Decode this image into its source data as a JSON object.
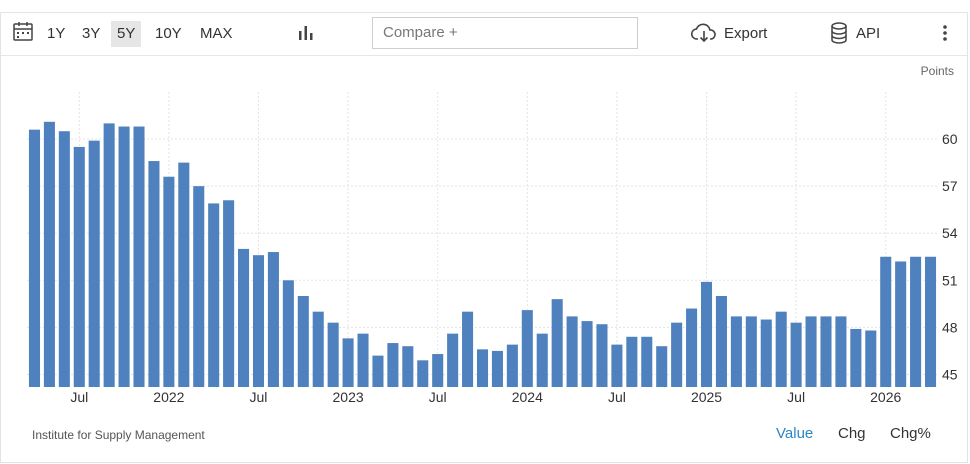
{
  "toolbar": {
    "ranges": [
      "1Y",
      "3Y",
      "5Y",
      "10Y",
      "MAX"
    ],
    "active_range": "5Y",
    "compare_placeholder": "Compare +",
    "export_label": "Export",
    "api_label": "API",
    "icons": {
      "calendar": "calendar-icon",
      "chart_type": "bar-chart-icon",
      "export": "cloud-download-icon",
      "api": "database-icon",
      "more": "vertical-dots-icon"
    }
  },
  "units_label": "Points",
  "source": "Institute for Supply Management",
  "modes": [
    "Value",
    "Chg",
    "Chg%"
  ],
  "active_mode": "Value",
  "colors": {
    "bar": "#4e81bd",
    "accent": "#2b86c5",
    "grid": "#e3e3e3"
  },
  "chart_data": {
    "type": "bar",
    "title": "",
    "xlabel": "",
    "ylabel": "",
    "ylim": [
      44.2,
      63.0
    ],
    "yticks": [
      45,
      48,
      51,
      54,
      57,
      60
    ],
    "x_tick_labels": [
      "Jul",
      "2022",
      "Jul",
      "2023",
      "Jul",
      "2024",
      "Jul",
      "2025",
      "Jul",
      "2026"
    ],
    "x_tick_month_index": [
      3,
      9,
      15,
      21,
      27,
      33,
      39,
      45,
      51,
      57
    ],
    "series": [
      {
        "values": [
          60.6,
          61.1,
          60.5,
          59.5,
          59.9,
          61.0,
          60.8,
          60.8,
          58.6,
          57.6,
          58.5,
          57.0,
          55.9,
          56.1,
          53.0,
          52.6,
          52.8,
          51.0,
          50.0,
          49.0,
          48.3,
          47.3,
          47.6,
          46.2,
          47.0,
          46.8,
          45.9,
          46.3,
          47.6,
          49.0,
          46.6,
          46.5,
          46.9,
          49.1,
          47.6,
          49.8,
          48.7,
          48.4,
          48.2,
          46.9,
          47.4,
          47.4,
          46.8,
          48.3,
          49.2,
          50.9,
          50.0,
          48.7,
          48.7,
          48.5,
          49.0,
          48.3,
          48.7,
          48.7,
          48.7,
          47.9,
          47.8,
          52.5,
          52.2,
          52.5,
          52.5
        ]
      }
    ]
  }
}
